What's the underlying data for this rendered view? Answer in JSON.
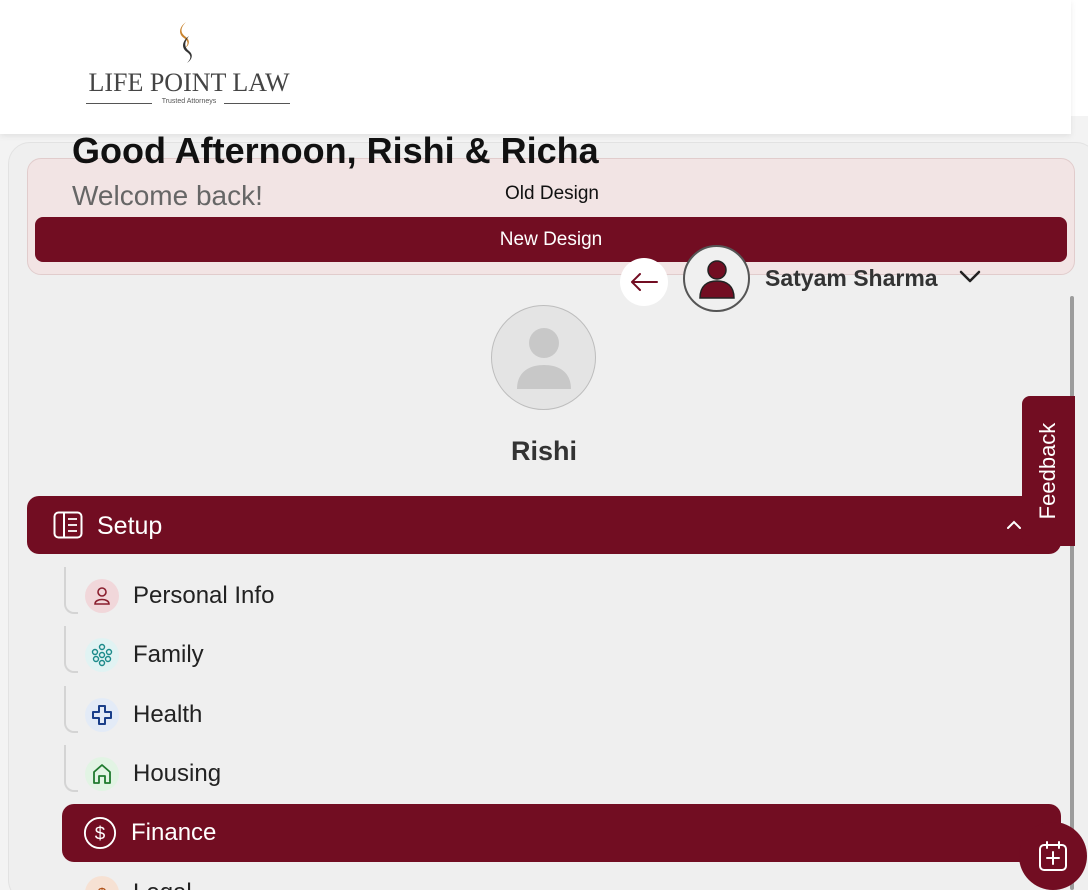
{
  "brand": {
    "name": "LIFE POINT LAW",
    "tagline": "Trusted Attorneys"
  },
  "greeting": {
    "title": "Good Afternoon, Rishi & Richa",
    "subtitle": "Welcome back!"
  },
  "design_switch": {
    "old_label": "Old Design",
    "new_label": "New Design"
  },
  "user": {
    "name": "Satyam Sharma"
  },
  "profile": {
    "name": "Rishi"
  },
  "setup": {
    "label": "Setup",
    "items": [
      {
        "label": "Personal Info",
        "icon": "person-icon",
        "active": false
      },
      {
        "label": "Family",
        "icon": "family-icon",
        "active": false
      },
      {
        "label": "Health",
        "icon": "health-cross-icon",
        "active": false
      },
      {
        "label": "Housing",
        "icon": "house-icon",
        "active": false
      },
      {
        "label": "Finance",
        "icon": "dollar-icon",
        "active": true
      },
      {
        "label": "Legal",
        "icon": "legal-icon",
        "active": false
      }
    ]
  },
  "feedback": {
    "label": "Feedback"
  },
  "colors": {
    "brand": "#720d22",
    "design_box_bg": "#f2e4e4",
    "panel_bg": "#efefef"
  }
}
